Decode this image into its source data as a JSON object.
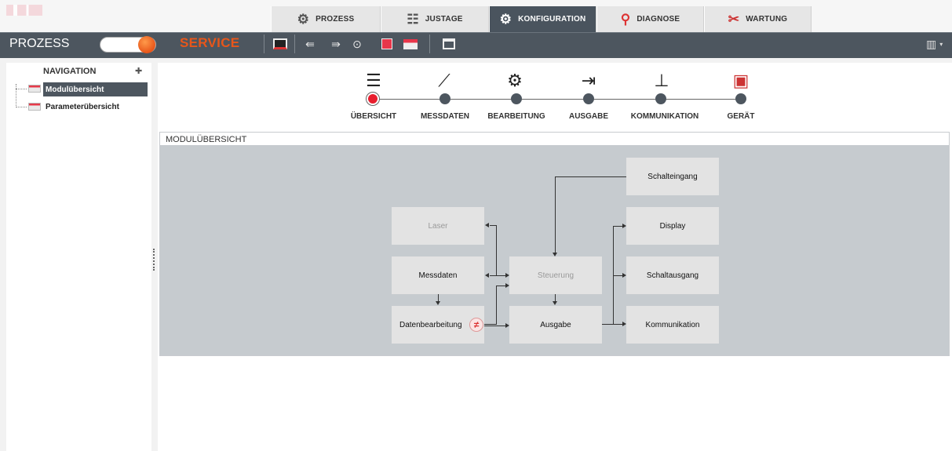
{
  "top_tabs": [
    {
      "label": "PROZESS",
      "icon": "gears-icon",
      "active": false
    },
    {
      "label": "JUSTAGE",
      "icon": "sliders-icon",
      "active": false
    },
    {
      "label": "KONFIGURATION",
      "icon": "config-gears-icon",
      "active": true
    },
    {
      "label": "DIAGNOSE",
      "icon": "stethoscope-icon",
      "active": false
    },
    {
      "label": "WARTUNG",
      "icon": "tools-icon",
      "active": false
    }
  ],
  "toolbar": {
    "mode_label": "PROZESS",
    "service_label": "SERVICE",
    "colors": {
      "accent": "#e8561a",
      "toolbar_bg": "#4d565f",
      "active_dot": "#e81e2e"
    }
  },
  "navigation": {
    "title": "NAVIGATION",
    "items": [
      {
        "label": "Modulübersicht",
        "selected": true
      },
      {
        "label": "Parameterübersicht",
        "selected": false
      }
    ]
  },
  "steps": [
    {
      "label": "ÜBERSICHT",
      "icon": "list-icon",
      "active": true
    },
    {
      "label": "MESSDATEN",
      "icon": "line-chart-icon",
      "active": false
    },
    {
      "label": "BEARBEITUNG",
      "icon": "chart-gear-icon",
      "active": false
    },
    {
      "label": "AUSGABE",
      "icon": "export-icon",
      "active": false
    },
    {
      "label": "KOMMUNIKATION",
      "icon": "network-icon",
      "active": false
    },
    {
      "label": "GERÄT",
      "icon": "device-icon",
      "active": false
    }
  ],
  "panel": {
    "title": "MODULÜBERSICHT",
    "modules": {
      "laser": "Laser",
      "messdaten": "Messdaten",
      "datenbearbeitung": "Datenbearbeitung",
      "steuerung": "Steuerung",
      "ausgabe": "Ausgabe",
      "schalteingang": "Schalteingang",
      "display": "Display",
      "schaltausgang": "Schaltausgang",
      "kommunikation": "Kommunikation"
    }
  }
}
